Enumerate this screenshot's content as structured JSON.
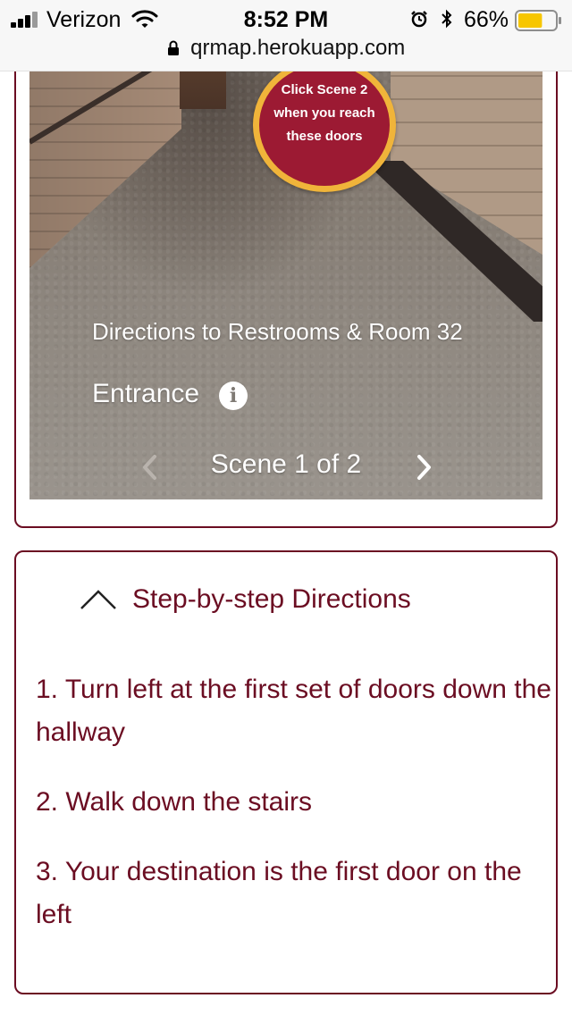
{
  "status_bar": {
    "carrier": "Verizon",
    "time": "8:52 PM",
    "battery": "66%",
    "battery_level": 0.66
  },
  "browser": {
    "url": "qrmap.herokuapp.com"
  },
  "scene": {
    "callout_lines": [
      "Click Scene 2",
      "when you reach",
      "these doors"
    ],
    "destination": "Directions to Restrooms & Room 32",
    "name": "Entrance",
    "indicator": "Scene 1 of 2"
  },
  "directions": {
    "title": "Step-by-step Directions",
    "steps": [
      "1. Turn left at the first set of doors down the hallway",
      "2. Walk down the stairs",
      "3. Your destination is the first door on the left"
    ]
  },
  "colors": {
    "accent": "#6b0d22",
    "callout_fill": "#9c1a33",
    "callout_ring": "#f0b43a",
    "battery_fill": "#f7c600"
  },
  "icons": [
    "signal-icon",
    "wifi-icon",
    "alarm-icon",
    "bluetooth-icon",
    "battery-icon",
    "lock-icon",
    "info-icon",
    "chevron-left-icon",
    "chevron-right-icon",
    "chevron-up-icon"
  ]
}
